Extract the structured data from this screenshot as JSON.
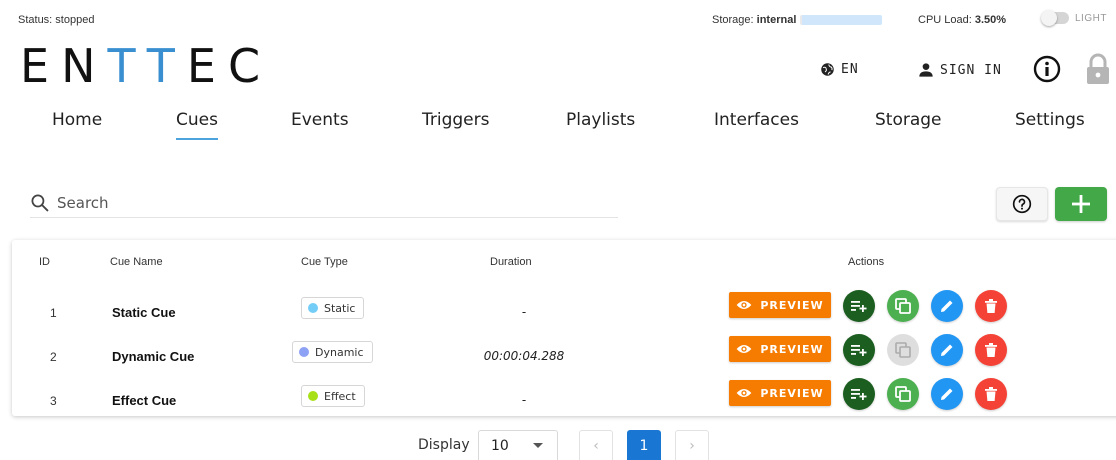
{
  "status": {
    "label": "Status: ",
    "value": "stopped"
  },
  "storage": {
    "label": "Storage: ",
    "value": "internal"
  },
  "cpu": {
    "label": "CPU Load: ",
    "value": "3.50%"
  },
  "theme": {
    "label": "LIGHT"
  },
  "logo": {
    "part1": "EN",
    "part2": "TT",
    "part3": "EC"
  },
  "header": {
    "language": "EN",
    "sign_in": "SIGN IN"
  },
  "nav": {
    "tabs": [
      {
        "label": "Home"
      },
      {
        "label": "Cues"
      },
      {
        "label": "Events"
      },
      {
        "label": "Triggers"
      },
      {
        "label": "Playlists"
      },
      {
        "label": "Interfaces"
      },
      {
        "label": "Storage"
      },
      {
        "label": "Settings"
      }
    ],
    "active": "Cues"
  },
  "search": {
    "placeholder": "Search",
    "value": ""
  },
  "table": {
    "headers": {
      "id": "ID",
      "name": "Cue Name",
      "type": "Cue Type",
      "duration": "Duration",
      "actions": "Actions"
    },
    "rows": [
      {
        "id": "1",
        "name": "Static Cue",
        "type": "Static",
        "type_color": "#74cdf7",
        "duration": "-",
        "copy_enabled": true
      },
      {
        "id": "2",
        "name": "Dynamic Cue",
        "type": "Dynamic",
        "type_color": "#8ea2f5",
        "duration": "00:00:04.288",
        "copy_enabled": false
      },
      {
        "id": "3",
        "name": "Effect Cue",
        "type": "Effect",
        "type_color": "#a7e017",
        "duration": "-",
        "copy_enabled": true
      }
    ],
    "preview_label": "PREVIEW"
  },
  "pagination": {
    "display_label": "Display",
    "page_size": "10",
    "current_page": "1",
    "prev": "‹",
    "next": "›"
  },
  "colors": {
    "accent_blue": "#3a8fd1",
    "preview_orange": "#f57c00",
    "add_green": "#43a847",
    "queue_dark_green": "#1b5e20",
    "copy_green": "#4caf50",
    "edit_blue": "#2196f3",
    "delete_red": "#f44336",
    "pager_blue": "#1976d2"
  }
}
